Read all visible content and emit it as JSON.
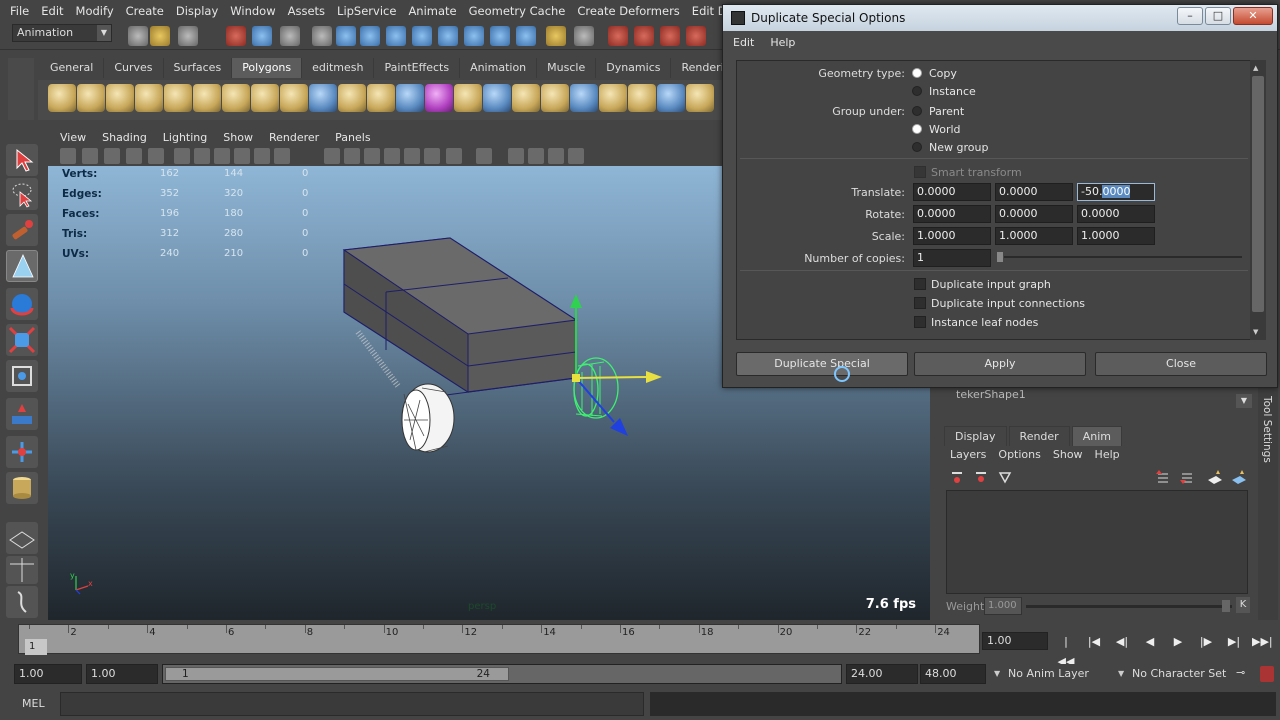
{
  "menubar": [
    "File",
    "Edit",
    "Modify",
    "Create",
    "Display",
    "Window",
    "Assets",
    "LipService",
    "Animate",
    "Geometry Cache",
    "Create Deformers",
    "Edit Deformers"
  ],
  "status": {
    "mode": "Animation"
  },
  "shelf_tabs": [
    "General",
    "Curves",
    "Surfaces",
    "Polygons",
    "editmesh",
    "PaintEffects",
    "Animation",
    "Muscle",
    "Dynamics",
    "Rendering"
  ],
  "shelf_active": "Polygons",
  "viewport": {
    "menu": [
      "View",
      "Shading",
      "Lighting",
      "Show",
      "Renderer",
      "Panels"
    ],
    "hud_rows": [
      {
        "label": "Verts:",
        "a": "162",
        "b": "144",
        "c": "0"
      },
      {
        "label": "Edges:",
        "a": "352",
        "b": "320",
        "c": "0"
      },
      {
        "label": "Faces:",
        "a": "196",
        "b": "180",
        "c": "0"
      },
      {
        "label": "Tris:",
        "a": "312",
        "b": "280",
        "c": "0"
      },
      {
        "label": "UVs:",
        "a": "240",
        "b": "210",
        "c": "0"
      }
    ],
    "fps": "7.6 fps",
    "camera": "persp"
  },
  "timeline": {
    "ticks": [
      "2",
      "4",
      "6",
      "8",
      "10",
      "12",
      "14",
      "16",
      "18",
      "20",
      "22",
      "24"
    ],
    "start_frame": "1",
    "current_frame": "1.00"
  },
  "range": {
    "start": "1.00",
    "playback_start": "1.00",
    "handle_start": "1",
    "handle_end": "24",
    "playback_end": "24.00",
    "end": "48.00",
    "anim_layer": "No Anim Layer",
    "char_set": "No Character Set"
  },
  "command_line": {
    "label": "MEL"
  },
  "layer_editor": {
    "title": "tekerShape1",
    "tabs": [
      "Display",
      "Render",
      "Anim"
    ],
    "active_tab": "Anim",
    "menu": [
      "Layers",
      "Options",
      "Show",
      "Help"
    ],
    "weight_label": "Weight",
    "weight_value": "1.000",
    "weight_key": "K",
    "side_tab": "Tool Settings"
  },
  "dialog": {
    "title": "Duplicate Special Options",
    "menu": [
      "Edit",
      "Help"
    ],
    "geometry_type_label": "Geometry type:",
    "geometry_options": [
      "Copy",
      "Instance"
    ],
    "geometry_selected": "Copy",
    "group_under_label": "Group under:",
    "group_options": [
      "Parent",
      "World",
      "New group"
    ],
    "group_selected": "World",
    "smart_transform": "Smart transform",
    "translate_label": "Translate:",
    "translate": [
      "0.0000",
      "0.0000",
      "-50.0000"
    ],
    "rotate_label": "Rotate:",
    "rotate": [
      "0.0000",
      "0.0000",
      "0.0000"
    ],
    "scale_label": "Scale:",
    "scale": [
      "1.0000",
      "1.0000",
      "1.0000"
    ],
    "copies_label": "Number of copies:",
    "copies": "1",
    "checkboxes": [
      "Duplicate input graph",
      "Duplicate input connections",
      "Instance leaf nodes"
    ],
    "buttons": {
      "duplicate": "Duplicate Special",
      "apply": "Apply",
      "close": "Close"
    }
  }
}
